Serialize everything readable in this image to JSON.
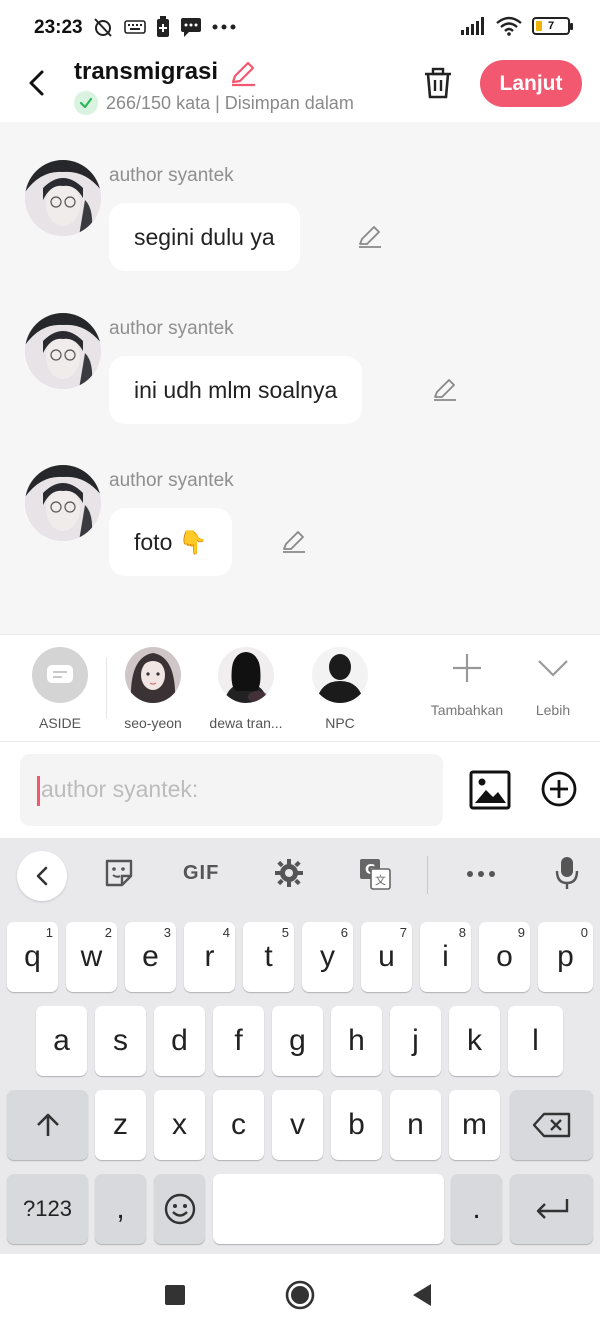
{
  "status_bar": {
    "time": "23:23",
    "battery_level": "7"
  },
  "header": {
    "title": "transmigrasi",
    "word_count": "266/150 kata | Disimpan dalam",
    "next_label": "Lanjut",
    "accent_color": "#f2586f"
  },
  "messages": [
    {
      "author": "author syantek",
      "text": "segini dulu ya"
    },
    {
      "author": "author syantek",
      "text": "ini udh mlm soalnya"
    },
    {
      "author": "author syantek",
      "text": "foto 👇"
    }
  ],
  "characters": [
    {
      "name": "ASIDE"
    },
    {
      "name": "seo-yeon"
    },
    {
      "name": "dewa tran..."
    },
    {
      "name": "NPC"
    }
  ],
  "actions": {
    "add_label": "Tambahkan",
    "more_label": "Lebih"
  },
  "composer": {
    "placeholder": "author syantek:"
  },
  "keyboard": {
    "gif_label": "GIF",
    "row1": [
      {
        "k": "q",
        "n": "1"
      },
      {
        "k": "w",
        "n": "2"
      },
      {
        "k": "e",
        "n": "3"
      },
      {
        "k": "r",
        "n": "4"
      },
      {
        "k": "t",
        "n": "5"
      },
      {
        "k": "y",
        "n": "6"
      },
      {
        "k": "u",
        "n": "7"
      },
      {
        "k": "i",
        "n": "8"
      },
      {
        "k": "o",
        "n": "9"
      },
      {
        "k": "p",
        "n": "0"
      }
    ],
    "row2": [
      "a",
      "s",
      "d",
      "f",
      "g",
      "h",
      "j",
      "k",
      "l"
    ],
    "row3": [
      "z",
      "x",
      "c",
      "v",
      "b",
      "n",
      "m"
    ],
    "symbols_label": "?123",
    "comma_label": ",",
    "period_label": "."
  }
}
